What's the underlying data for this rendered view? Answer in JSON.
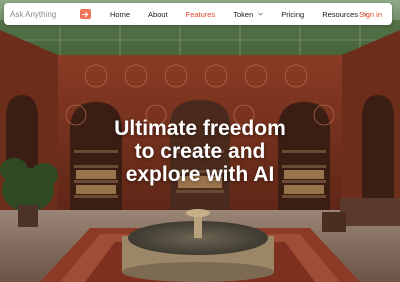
{
  "search": {
    "placeholder": "Ask Anything",
    "button_icon": "arrow-right-icon"
  },
  "nav": {
    "items": [
      {
        "label": "Home",
        "active": false,
        "dropdown": false
      },
      {
        "label": "About",
        "active": false,
        "dropdown": false
      },
      {
        "label": "Features",
        "active": true,
        "dropdown": false
      },
      {
        "label": "Token",
        "active": false,
        "dropdown": true
      },
      {
        "label": "Pricing",
        "active": false,
        "dropdown": false
      },
      {
        "label": "Resources",
        "active": false,
        "dropdown": true
      }
    ],
    "signin": "Sign in"
  },
  "hero": {
    "headline_lines": [
      "Ultimate freedom",
      "to create and",
      "explore with AI"
    ]
  },
  "colors": {
    "accent": "#e4452a",
    "button": "#f0735a",
    "wall": "#7a3320",
    "text": "#ffffff"
  }
}
